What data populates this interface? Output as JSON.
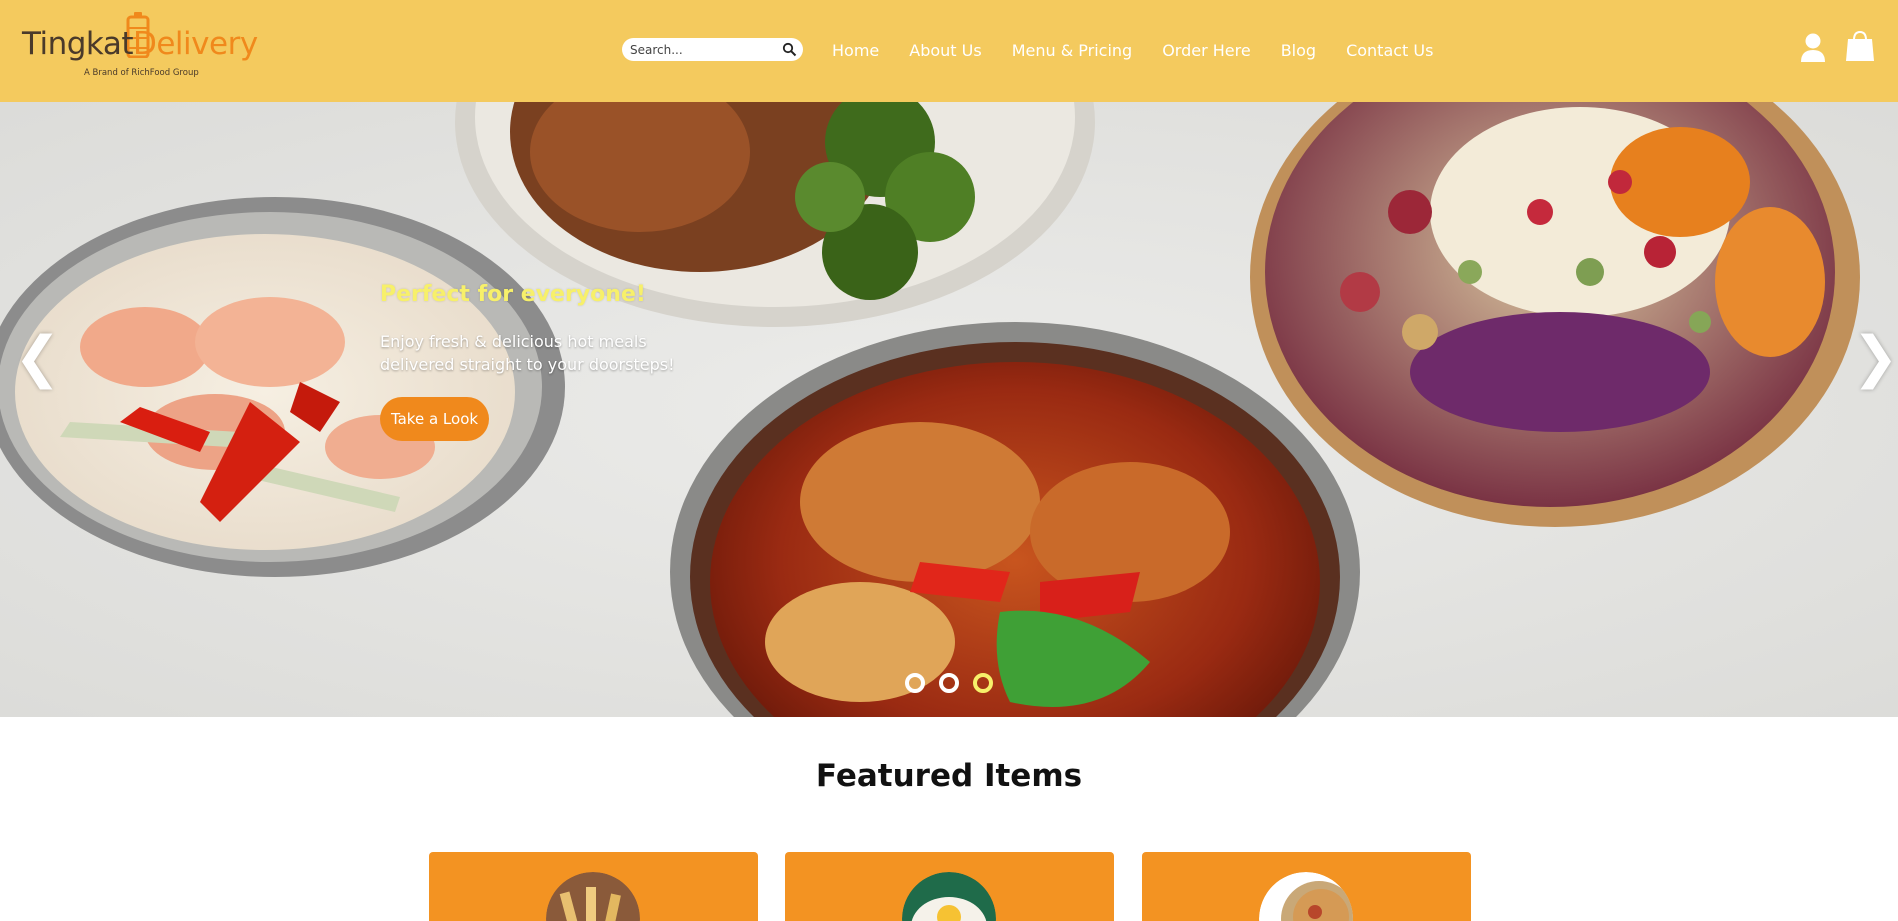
{
  "brand": {
    "name_part1": "Tingkat",
    "name_part2": "Delivery",
    "tagline": "A Brand of RichFood Group"
  },
  "search": {
    "placeholder": "Search..."
  },
  "nav": {
    "items": [
      {
        "label": "Home"
      },
      {
        "label": "About Us"
      },
      {
        "label": "Menu & Pricing"
      },
      {
        "label": "Order Here"
      },
      {
        "label": "Blog"
      },
      {
        "label": "Contact Us"
      }
    ]
  },
  "icons": {
    "user": "user-icon",
    "cart": "shopping-bag-icon",
    "search": "search-icon",
    "prev": "chevron-left-icon",
    "next": "chevron-right-icon"
  },
  "hero": {
    "title": "Perfect for everyone!",
    "subtitle": "Enjoy fresh & delicious hot meals delivered straight to your doorsteps!",
    "button_label": "Take a Look",
    "prev_label": "❮",
    "next_label": "❯",
    "slide_count": 3,
    "active_slide": 3
  },
  "featured": {
    "title": "Featured Items",
    "cards": [
      {
        "name": "featured-card-1"
      },
      {
        "name": "featured-card-2"
      },
      {
        "name": "featured-card-3"
      }
    ]
  },
  "colors": {
    "header_bg": "#f4ca5e",
    "accent_orange": "#f0891c",
    "card_orange": "#f39322",
    "hero_title": "#f7f06a",
    "nav_text": "#ffffff"
  }
}
